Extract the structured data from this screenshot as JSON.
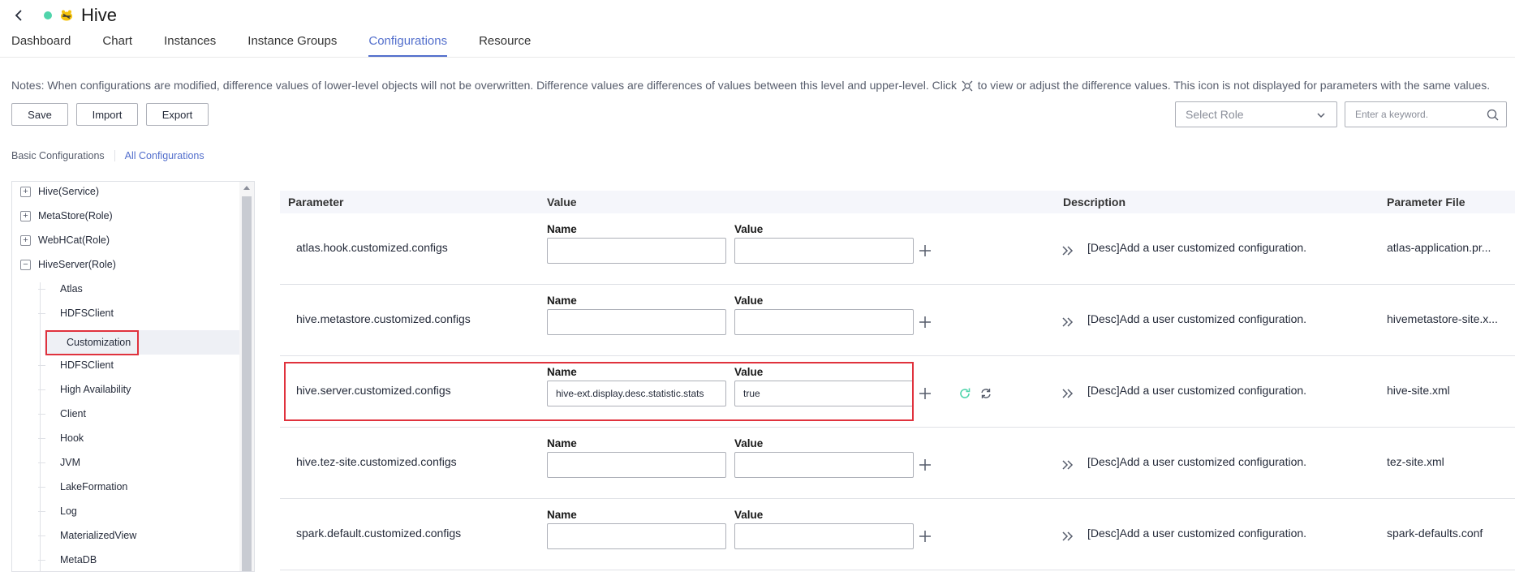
{
  "app": {
    "title": "Hive",
    "status_color": "#50d4ab"
  },
  "tabs": [
    {
      "label": "Dashboard"
    },
    {
      "label": "Chart"
    },
    {
      "label": "Instances"
    },
    {
      "label": "Instance Groups"
    },
    {
      "label": "Configurations",
      "active": true
    },
    {
      "label": "Resource"
    }
  ],
  "notes": {
    "before": "Notes: When configurations are modified, difference values of lower-level objects will not be overwritten. Difference values are differences of values between this level and upper-level. Click",
    "after": "to view or adjust the difference values. This icon is not displayed for parameters with the same values."
  },
  "toolbar": {
    "save": "Save",
    "import": "Import",
    "export": "Export"
  },
  "role_select": {
    "placeholder": "Select Role"
  },
  "search": {
    "placeholder": "Enter a keyword."
  },
  "subtabs": {
    "basic": "Basic Configurations",
    "all": "All Configurations"
  },
  "tree": {
    "nodes": [
      {
        "label": "Hive(Service)",
        "expander": "+"
      },
      {
        "label": "MetaStore(Role)",
        "expander": "+"
      },
      {
        "label": "WebHCat(Role)",
        "expander": "+"
      },
      {
        "label": "HiveServer(Role)",
        "expander": "−"
      }
    ],
    "leaves": [
      {
        "label": "Atlas"
      },
      {
        "label": "HDFSClient"
      },
      {
        "label": "Customization",
        "selected": true
      },
      {
        "label": "HDFSClient"
      },
      {
        "label": "High Availability"
      },
      {
        "label": "Client"
      },
      {
        "label": "Hook"
      },
      {
        "label": "JVM"
      },
      {
        "label": "LakeFormation"
      },
      {
        "label": "Log"
      },
      {
        "label": "MaterializedView"
      },
      {
        "label": "MetaDB"
      }
    ]
  },
  "table": {
    "headers": {
      "parameter": "Parameter",
      "value": "Value",
      "description": "Description",
      "file": "Parameter File"
    },
    "name_label": "Name",
    "value_label": "Value",
    "rows": [
      {
        "parameter": "atlas.hook.customized.configs",
        "name": "",
        "value": "",
        "description": "[Desc]Add a user customized configuration.",
        "file": "atlas-application.pr..."
      },
      {
        "parameter": "hive.metastore.customized.configs",
        "name": "",
        "value": "",
        "description": "[Desc]Add a user customized configuration.",
        "file": "hivemetastore-site.x..."
      },
      {
        "parameter": "hive.server.customized.configs",
        "name": "hive-ext.display.desc.statistic.stats",
        "value": "true",
        "description": "[Desc]Add a user customized configuration.",
        "file": "hive-site.xml"
      },
      {
        "parameter": "hive.tez-site.customized.configs",
        "name": "",
        "value": "",
        "description": "[Desc]Add a user customized configuration.",
        "file": "tez-site.xml"
      },
      {
        "parameter": "spark.default.customized.configs",
        "name": "",
        "value": "",
        "description": "[Desc]Add a user customized configuration.",
        "file": "spark-defaults.conf"
      }
    ]
  },
  "colors": {
    "accent": "#526ecc",
    "highlight_border": "#e0323d",
    "restore_icon": "#50d4ab"
  }
}
